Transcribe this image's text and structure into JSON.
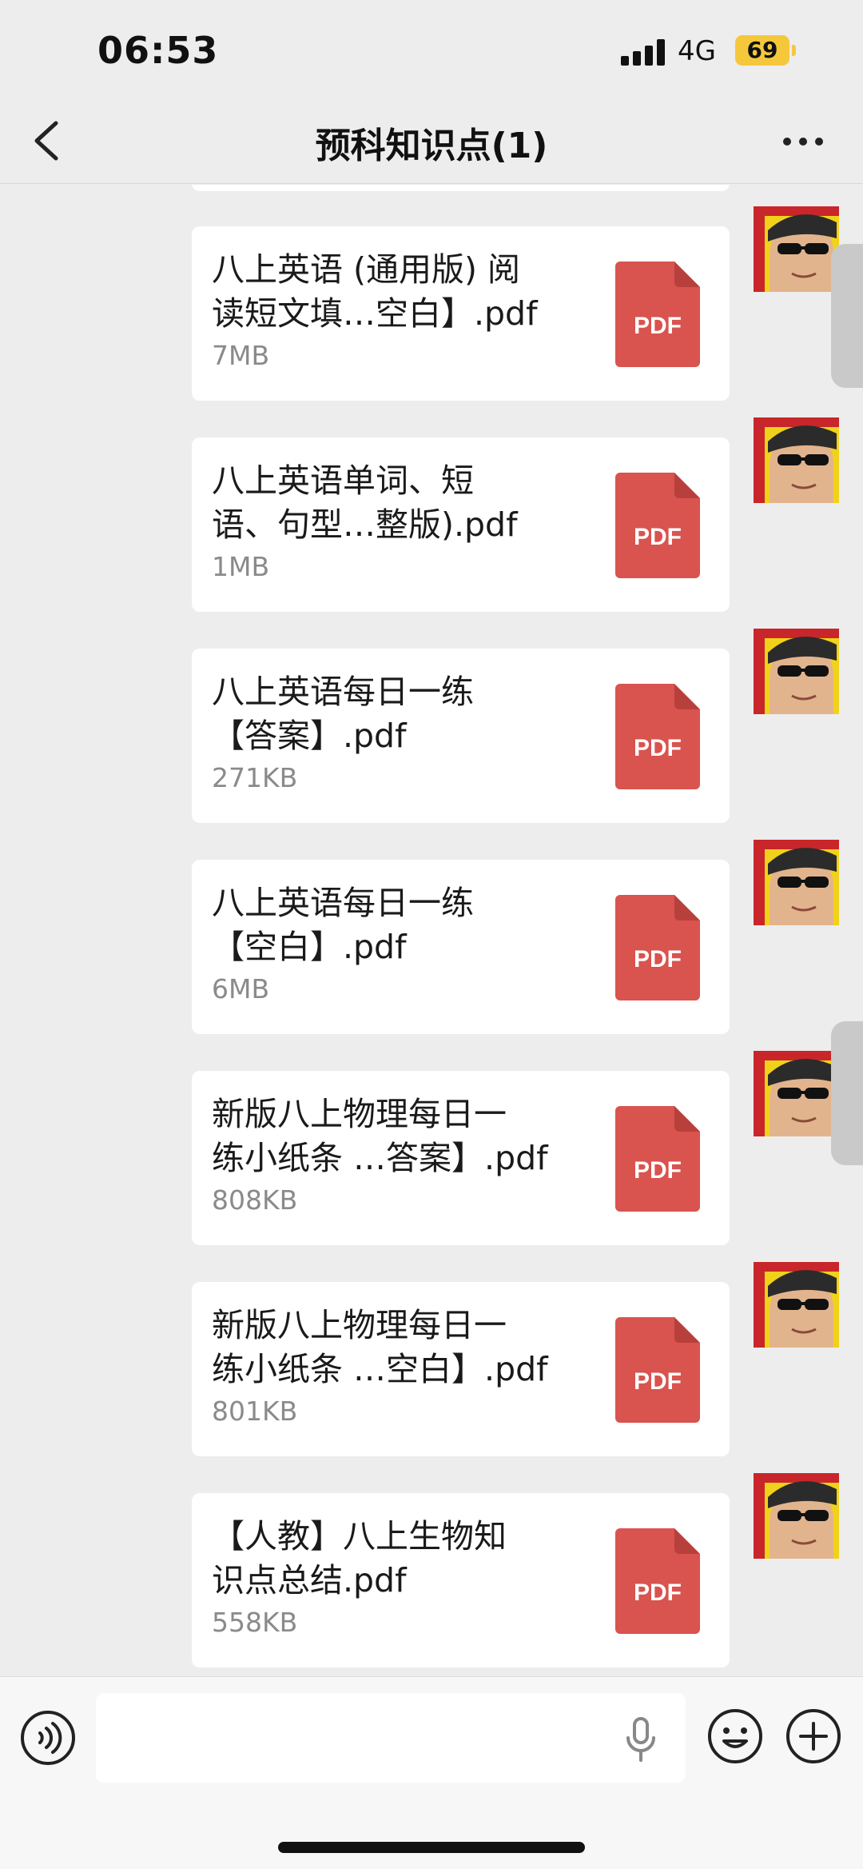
{
  "status_bar": {
    "time": "06:53",
    "network": "4G",
    "battery": "69",
    "battery_color": "#f5c83c"
  },
  "header": {
    "title": "预科知识点(1)",
    "back_icon": "chevron-left-icon",
    "more_icon": "more-dots-icon"
  },
  "messages": [
    {
      "name": "八上英语 (通用版) 阅\n读短文填…空白】.pdf",
      "size": "7MB",
      "icon_label": "PDF"
    },
    {
      "name": "八上英语单词、短\n语、句型…整版).pdf",
      "size": "1MB",
      "icon_label": "PDF"
    },
    {
      "name": "八上英语每日一练\n【答案】.pdf",
      "size": "271KB",
      "icon_label": "PDF"
    },
    {
      "name": "八上英语每日一练\n【空白】.pdf",
      "size": "6MB",
      "icon_label": "PDF"
    },
    {
      "name": "新版八上物理每日一\n练小纸条 …答案】.pdf",
      "size": "808KB",
      "icon_label": "PDF"
    },
    {
      "name": "新版八上物理每日一\n练小纸条 …空白】.pdf",
      "size": "801KB",
      "icon_label": "PDF"
    },
    {
      "name": "【人教】八上生物知\n识点总结.pdf",
      "size": "558KB",
      "icon_label": "PDF"
    }
  ],
  "colors": {
    "pdf_red": "#d9534f",
    "background": "#ededed"
  },
  "input_bar": {
    "voice_icon": "voice-icon",
    "mic_icon": "microphone-icon",
    "emoji_icon": "emoji-icon",
    "plus_icon": "plus-icon"
  }
}
